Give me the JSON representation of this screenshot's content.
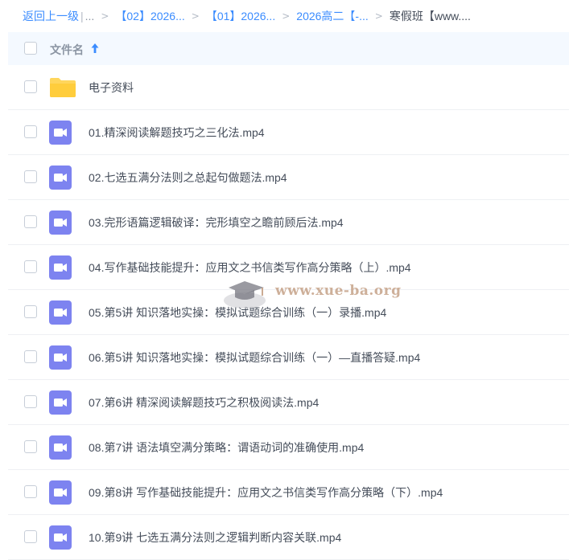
{
  "breadcrumb": {
    "back_label": "返回上一级",
    "sep": "|",
    "ellipsis": "...",
    "items": [
      "【02】2026...",
      "【01】2026...",
      "2026高二【-..."
    ],
    "current": "寒假班【www...."
  },
  "header": {
    "column_label": "文件名",
    "sort_direction": "ascending"
  },
  "files": [
    {
      "name": "电子资料",
      "type": "folder"
    },
    {
      "name": "01.精深阅读解题技巧之三化法.mp4",
      "type": "video"
    },
    {
      "name": "02.七选五满分法则之总起句做题法.mp4",
      "type": "video"
    },
    {
      "name": "03.完形语篇逻辑破译：完形填空之瞻前顾后法.mp4",
      "type": "video"
    },
    {
      "name": "04.写作基础技能提升：应用文之书信类写作高分策略（上）.mp4",
      "type": "video"
    },
    {
      "name": "05.第5讲 知识落地实操：模拟试题综合训练（一）录播.mp4",
      "type": "video"
    },
    {
      "name": "06.第5讲 知识落地实操：模拟试题综合训练（一）—直播答疑.mp4",
      "type": "video"
    },
    {
      "name": "07.第6讲 精深阅读解题技巧之积极阅读法.mp4",
      "type": "video"
    },
    {
      "name": "08.第7讲 语法填空满分策略：谓语动词的准确使用.mp4",
      "type": "video"
    },
    {
      "name": "09.第8讲 写作基础技能提升：应用文之书信类写作高分策略（下）.mp4",
      "type": "video"
    },
    {
      "name": "10.第9讲 七选五满分法则之逻辑判断内容关联.mp4",
      "type": "video"
    }
  ],
  "watermark": {
    "text": "www.xue-ba.org"
  },
  "icons": {
    "folder": "folder-icon",
    "video": "video-file-icon",
    "sort": "sort-arrow-up-icon"
  },
  "colors": {
    "accent": "#3b8cff",
    "folder": "#ffd65c",
    "video": "#7d83f0",
    "header_bg": "#f4f9ff"
  }
}
